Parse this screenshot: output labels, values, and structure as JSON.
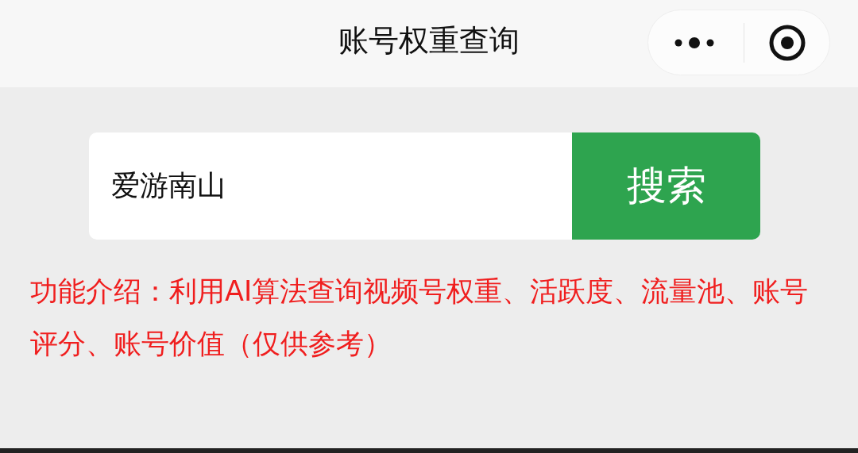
{
  "window": {
    "title": "账号权重查询"
  },
  "search": {
    "value": "爱游南山",
    "button": "搜索"
  },
  "intro": "功能介绍：利用AI算法查询视频号权重、活跃度、流量池、账号评分、账号价值（仅供参考）"
}
